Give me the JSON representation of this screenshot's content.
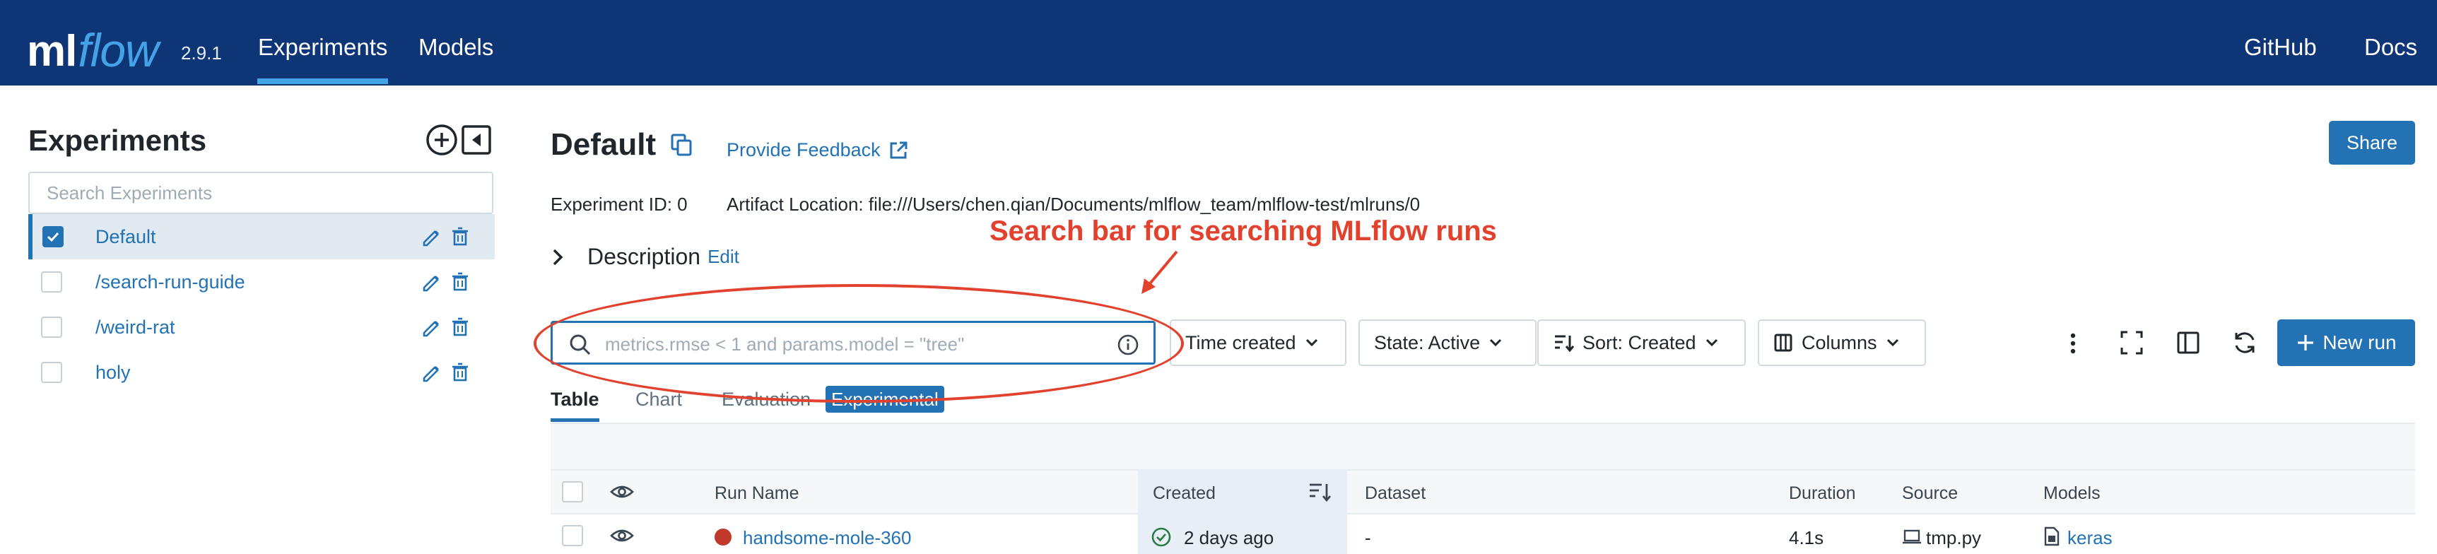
{
  "header": {
    "logo_ml": "ml",
    "logo_flow": "flow",
    "version": "2.9.1",
    "tabs": [
      {
        "label": "Experiments"
      },
      {
        "label": "Models"
      }
    ],
    "right_links": [
      {
        "label": "GitHub"
      },
      {
        "label": "Docs"
      }
    ],
    "background_color": "#0e3576",
    "accent_color": "#43a3e6"
  },
  "sidebar": {
    "title": "Experiments",
    "search_placeholder": "Search Experiments",
    "items": [
      {
        "label": "Default",
        "selected": true
      },
      {
        "label": "/search-run-guide",
        "selected": false
      },
      {
        "label": "/weird-rat",
        "selected": false
      },
      {
        "label": "holy",
        "selected": false
      }
    ]
  },
  "main": {
    "title": "Default",
    "feedback_link": "Provide Feedback",
    "share_label": "Share",
    "experiment_id": "Experiment ID: 0",
    "artifact_location": "Artifact Location: file:///Users/chen.qian/Documents/mlflow_team/mlflow-test/mlruns/0",
    "description_label": "Description",
    "description_edit": "Edit",
    "annotation": "Search bar for searching MLflow runs",
    "search_placeholder": "metrics.rmse < 1 and params.model = \"tree\"",
    "controls": {
      "time": "Time created",
      "state": "State: Active",
      "sort": "Sort: Created",
      "columns": "Columns",
      "new_run": "New run"
    },
    "tabs": [
      {
        "label": "Table"
      },
      {
        "label": "Chart"
      },
      {
        "label": "Evaluation"
      }
    ],
    "experimental_badge": "Experimental",
    "table": {
      "headers": [
        "Run Name",
        "Created",
        "Dataset",
        "Duration",
        "Source",
        "Models"
      ],
      "rows": [
        {
          "run_name": "handsome-mole-360",
          "created": "2 days ago",
          "dataset": "-",
          "duration": "4.1s",
          "source": "tmp.py",
          "models": "keras"
        }
      ]
    },
    "primary_color": "#2272b4",
    "annotation_color": "#e2412d"
  }
}
